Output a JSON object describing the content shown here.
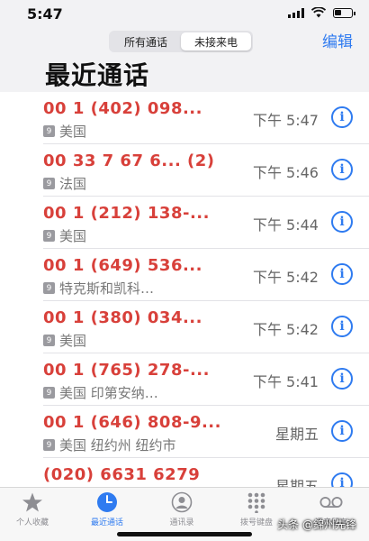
{
  "status": {
    "time": "5:47"
  },
  "header": {
    "segments": [
      "所有通话",
      "未接来电"
    ],
    "active_segment": 1,
    "edit_label": "编辑",
    "title": "最近通话"
  },
  "calls": [
    {
      "number": "00 1 (402) 098...",
      "location": "美国",
      "time": "下午 5:47"
    },
    {
      "number": "00 33 7 67 6... (2)",
      "location": "法国",
      "time": "下午 5:46"
    },
    {
      "number": "00 1 (212) 138-...",
      "location": "美国",
      "time": "下午 5:44"
    },
    {
      "number": "00 1 (649) 536...",
      "location": "特克斯和凯科…",
      "time": "下午 5:42"
    },
    {
      "number": "00 1 (380) 034...",
      "location": "美国",
      "time": "下午 5:42"
    },
    {
      "number": "00 1 (765) 278-...",
      "location": "美国 印第安纳…",
      "time": "下午 5:41"
    },
    {
      "number": "00 1 (646) 808-9...",
      "location": "美国 纽约州 纽约市",
      "time": "星期五"
    },
    {
      "number": "(020) 6631 6279",
      "location": "",
      "time": "星期五"
    }
  ],
  "tabbar": {
    "items": [
      {
        "label": "个人收藏",
        "icon": "star-icon"
      },
      {
        "label": "最近通话",
        "icon": "clock-icon"
      },
      {
        "label": "通讯录",
        "icon": "contact-icon"
      },
      {
        "label": "拨号键盘",
        "icon": "keypad-icon"
      },
      {
        "label": "语音留言",
        "icon": "voicemail-icon"
      }
    ],
    "active": 1
  },
  "watermark": "头条 @錦州先锋",
  "colors": {
    "accent": "#2f7bf0",
    "missed": "#d8403a"
  }
}
